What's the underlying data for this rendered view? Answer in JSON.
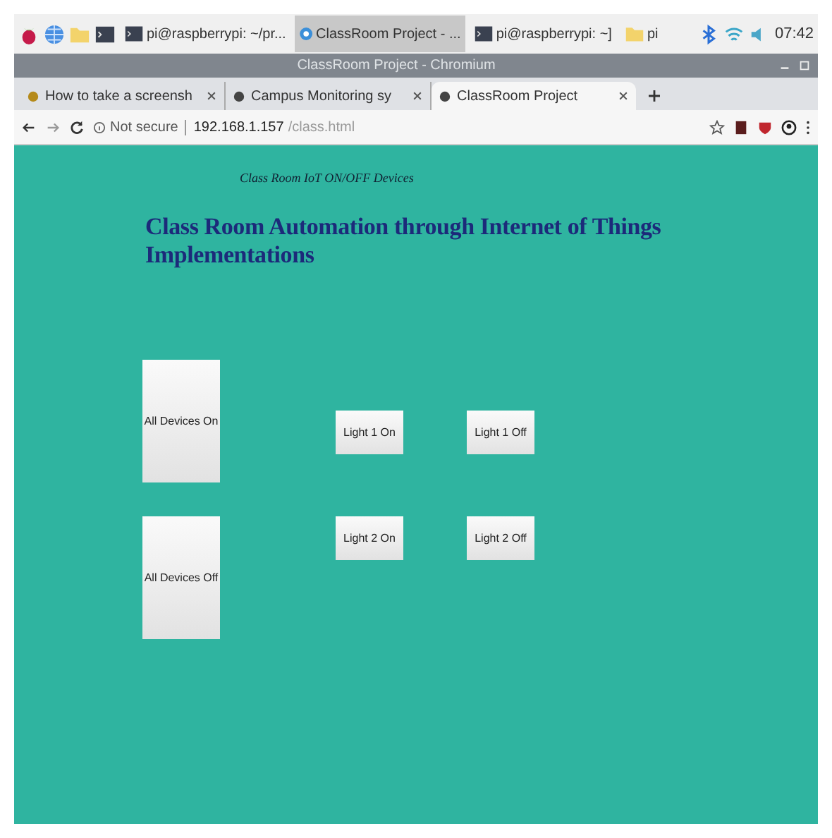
{
  "taskbar": {
    "tasks": [
      {
        "label": "pi@raspberrypi: ~/pr...",
        "kind": "terminal",
        "selected": false
      },
      {
        "label": "ClassRoom Project - ...",
        "kind": "browser",
        "selected": true
      },
      {
        "label": "pi@raspberrypi: ~]",
        "kind": "terminal",
        "selected": false
      },
      {
        "label": "pi",
        "kind": "folder",
        "selected": false
      }
    ],
    "clock": "07:42"
  },
  "window": {
    "title": "ClassRoom Project - Chromium"
  },
  "tabs": [
    {
      "label": "How to take a screensh",
      "selected": false
    },
    {
      "label": "Campus Monitoring sy",
      "selected": false
    },
    {
      "label": "ClassRoom Project",
      "selected": true
    }
  ],
  "address_bar": {
    "security": "Not secure",
    "host": "192.168.1.157",
    "path": "/class.html"
  },
  "page": {
    "subtitle": "Class Room IoT ON/OFF Devices",
    "heading": "Class Room Automation through Internet of Things Implementations",
    "all_buttons": [
      "All Devices On",
      "All Devices Off"
    ],
    "light_buttons": [
      [
        "Light 1 On",
        "Light 1 Off"
      ],
      [
        "Light 2 On",
        "Light 2 Off"
      ]
    ]
  }
}
